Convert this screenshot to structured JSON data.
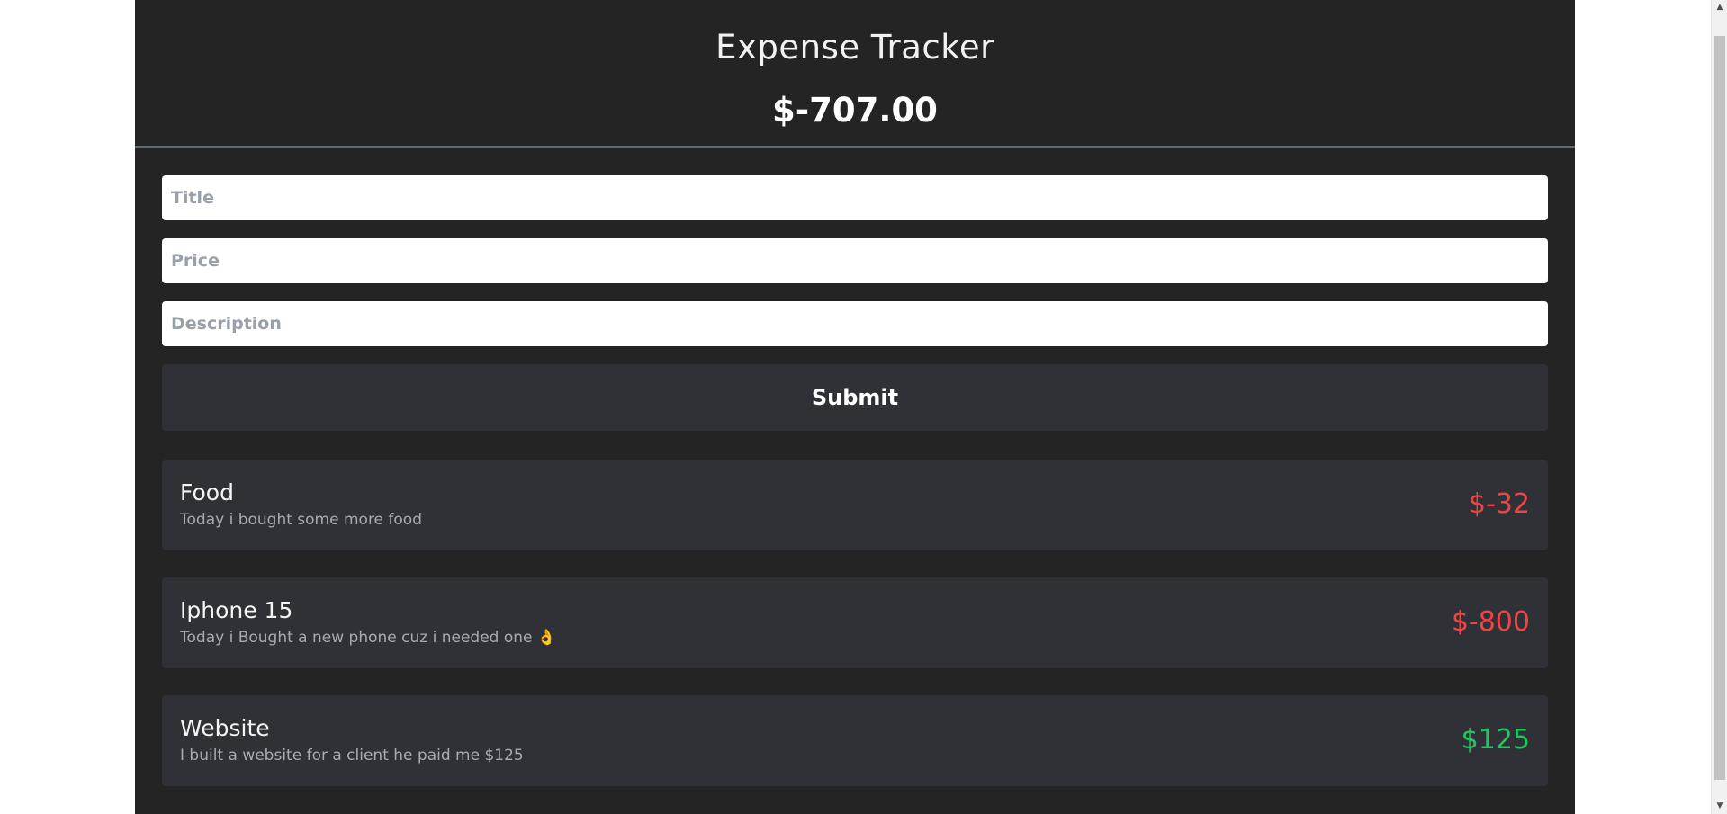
{
  "header": {
    "title": "Expense Tracker",
    "balance": "$-707.00"
  },
  "form": {
    "title_placeholder": "Title",
    "price_placeholder": "Price",
    "description_placeholder": "Description",
    "submit_label": "Submit"
  },
  "expenses": [
    {
      "title": "Food",
      "description": "Today i bought some more food",
      "amount": "$-32",
      "type": "negative"
    },
    {
      "title": "Iphone 15",
      "description": "Today i Bought a new phone cuz i needed one 👌",
      "amount": "$-800",
      "type": "negative"
    },
    {
      "title": "Website",
      "description": "I built a website for a client he paid me $125",
      "amount": "$125",
      "type": "positive"
    }
  ],
  "colors": {
    "background": "#242424",
    "card": "#2f3136",
    "negative": "#ef4444",
    "positive": "#22c55e"
  },
  "scrollbar": {
    "up_icon": "chevron-up-icon",
    "down_icon": "chevron-down-icon"
  }
}
